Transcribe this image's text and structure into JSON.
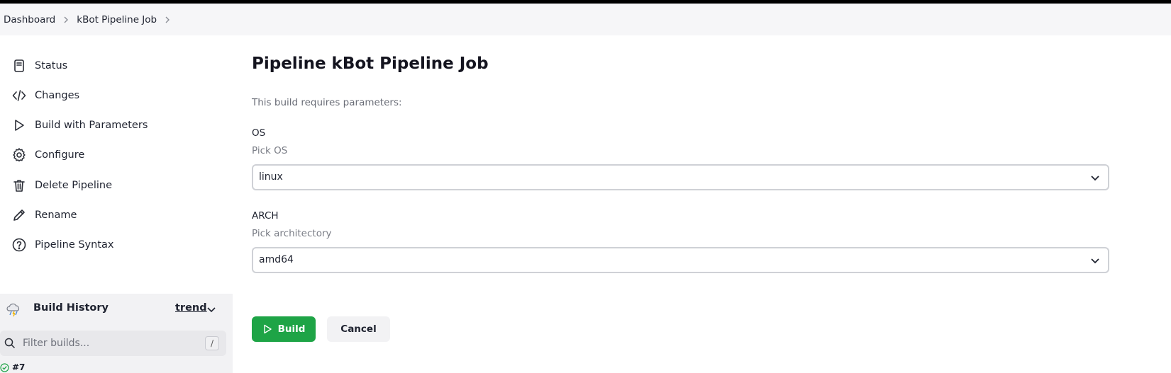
{
  "breadcrumb": {
    "items": [
      "Dashboard",
      "kBot Pipeline Job"
    ]
  },
  "sidebar": {
    "items": [
      {
        "label": "Status",
        "icon": "document-icon"
      },
      {
        "label": "Changes",
        "icon": "code-icon"
      },
      {
        "label": "Build with Parameters",
        "icon": "play-icon"
      },
      {
        "label": "Configure",
        "icon": "gear-icon"
      },
      {
        "label": "Delete Pipeline",
        "icon": "trash-icon"
      },
      {
        "label": "Rename",
        "icon": "pencil-icon"
      },
      {
        "label": "Pipeline Syntax",
        "icon": "help-circle-icon"
      }
    ]
  },
  "build_history": {
    "title": "Build History",
    "trend_label": "trend",
    "filter_placeholder": "Filter builds...",
    "shortcut_hint": "/",
    "builds": [
      {
        "number": "#7",
        "status": "success"
      }
    ]
  },
  "main": {
    "title": "Pipeline kBot Pipeline Job",
    "intro": "This build requires parameters:",
    "params": [
      {
        "name": "OS",
        "description": "Pick OS",
        "selected": "linux"
      },
      {
        "name": "ARCH",
        "description": "Pick architectory",
        "selected": "amd64"
      }
    ],
    "build_label": "Build",
    "cancel_label": "Cancel"
  },
  "colors": {
    "accent_green": "#1ea446",
    "breadcrumb_bg": "#f6f6f8",
    "panel_bg": "#f2f2f4"
  }
}
